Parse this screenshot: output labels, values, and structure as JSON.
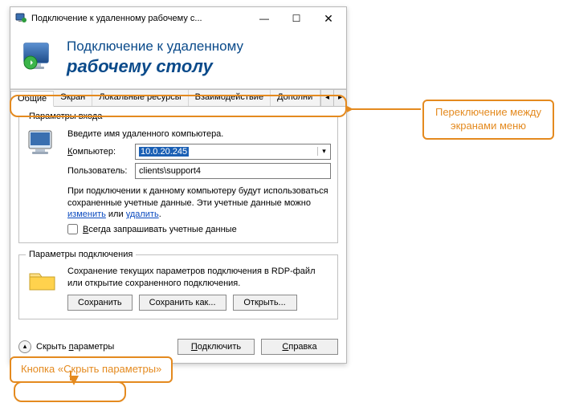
{
  "titlebar": {
    "text": "Подключение к удаленному рабочему с..."
  },
  "banner": {
    "line1": "Подключение к удаленному",
    "line2": "рабочему столу"
  },
  "tabs": {
    "items": [
      {
        "label": "Общие"
      },
      {
        "label": "Экран"
      },
      {
        "label": "Локальные ресурсы"
      },
      {
        "label": "Взаимодействие"
      },
      {
        "label": "Дополни"
      }
    ]
  },
  "login": {
    "legend": "Параметры входа",
    "hint": "Введите имя удаленного компьютера.",
    "computer_label": "Компьютер:",
    "computer_value": "10.0.20.245",
    "user_label": "Пользователь:",
    "user_value": "clients\\support4",
    "note_pre": "При подключении к данному компьютеру будут использоваться сохраненные учетные данные.  Эти учетные данные можно ",
    "note_change": "изменить",
    "note_mid": " или ",
    "note_delete": "удалить",
    "note_post": ".",
    "always_label": "Всегда запрашивать учетные данные"
  },
  "conn": {
    "legend": "Параметры подключения",
    "desc": "Сохранение текущих параметров подключения в RDP-файл или открытие сохраненного подключения.",
    "save": "Сохранить",
    "saveas": "Сохранить как...",
    "open": "Открыть..."
  },
  "footer": {
    "toggle": "Скрыть параметры",
    "connect": "Подключить",
    "help": "Справка"
  },
  "callouts": {
    "right": "Переключение между экранами меню",
    "left": "Кнопка «Скрыть параметры»"
  }
}
